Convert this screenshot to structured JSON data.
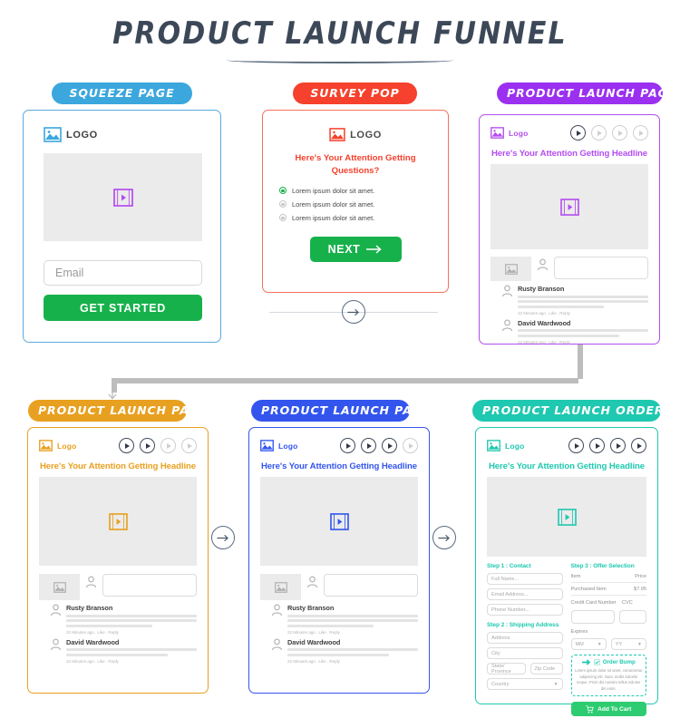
{
  "header": {
    "title": "PRODUCT LAUNCH FUNNEL"
  },
  "colors": {
    "squeeze": "#3ba7dd",
    "survey": "#f5412d",
    "launch_purple": "#9b30f0",
    "launch_orange": "#e8a020",
    "launch_blue": "#3355ee",
    "order_form": "#1fc8b0",
    "green_cta": "#17b14b",
    "title": "#3c4858"
  },
  "cards": {
    "squeeze": {
      "pill": "SQUEEZE PAGE",
      "logo_text": "LOGO",
      "logo_icon": "image-icon",
      "video_icon": "film-play-icon",
      "email_placeholder": "Email",
      "cta_label": "GET STARTED"
    },
    "survey": {
      "pill": "SURVEY POP",
      "logo_text": "LOGO",
      "logo_icon": "image-icon",
      "question": "Here's Your Attention Getting Questions?",
      "options": [
        {
          "label": "Lorem ipsum dolor sit amet.",
          "selected": true
        },
        {
          "label": "Lorem ipsum dolor sit amet.",
          "selected": false
        },
        {
          "label": "Lorem ipsum dolor sit amet.",
          "selected": false
        }
      ],
      "cta_label": "NEXT",
      "cta_icon": "arrow-right-icon"
    },
    "launch_purple": {
      "pill": "PRODUCT LAUNCH PAGE",
      "logo_text": "Logo",
      "headline": "Here's Your Attention Getting Headline",
      "play_buttons": [
        true,
        false,
        false,
        false
      ],
      "comments": [
        {
          "name": "Rusty Branson",
          "meta": "22 Minutes ago . Like . Reply"
        },
        {
          "name": "David Wardwood",
          "meta": "22 Minutes ago . Like . Reply"
        }
      ]
    },
    "launch_orange": {
      "pill": "PRODUCT LAUNCH PAGE",
      "logo_text": "Logo",
      "headline": "Here's Your Attention Getting Headline",
      "play_buttons": [
        true,
        true,
        false,
        false
      ],
      "comments": [
        {
          "name": "Rusty Branson",
          "meta": "22 Minutes ago . Like . Reply"
        },
        {
          "name": "David Wardwood",
          "meta": "22 Minutes ago . Like . Reply"
        }
      ]
    },
    "launch_blue": {
      "pill": "PRODUCT LAUNCH PAGE",
      "logo_text": "Logo",
      "headline": "Here's Your Attention Getting Headline",
      "play_buttons": [
        true,
        true,
        true,
        false
      ],
      "comments": [
        {
          "name": "Rusty Branson",
          "meta": "22 Minutes ago . Like . Reply"
        },
        {
          "name": "David Wardwood",
          "meta": "22 Minutes ago . Like . Reply"
        }
      ]
    },
    "order_form": {
      "pill": "PRODUCT LAUNCH ORDER FORM",
      "logo_text": "Logo",
      "headline": "Here's Your Attention Getting Headline",
      "play_buttons": [
        true,
        true,
        true,
        true
      ],
      "step1_title": "Step 1 : Contact",
      "step1_fields": [
        "Full Name...",
        "Email Address...",
        "Phone Number..."
      ],
      "step2_title": "Step 2 : Shipping Address",
      "step2_fields": [
        "Address",
        "City"
      ],
      "step2_row": [
        "State/ Province",
        "Zip Code"
      ],
      "step2_country": "Country",
      "step3_title": "Step 3 : Offer Selection",
      "item_header": "Item",
      "price_header": "Price",
      "item_name": "Purchased Item",
      "item_price": "$7.95",
      "card_label": "Credit Card Number",
      "cvc_label": "CVC",
      "expires_label": "Expires",
      "expires_month": "MM",
      "expires_year": "YY",
      "bump_title": "Order Bump",
      "bump_icon": "arrow-right-icon",
      "bump_check_icon": "check-icon",
      "bump_text": "Lorem ipsum dolor sit amet, consectetur adipiscing elit. Nunc mollis lobortis neque. Proin dis nonsim tellus volume dis enim.",
      "cart_label": "Add To Cart",
      "cart_icon": "shopping-cart-icon"
    }
  },
  "connectors": {
    "arrow_icon": "arrow-right-circle-icon",
    "down_arrow_icon": "arrow-down-icon"
  }
}
